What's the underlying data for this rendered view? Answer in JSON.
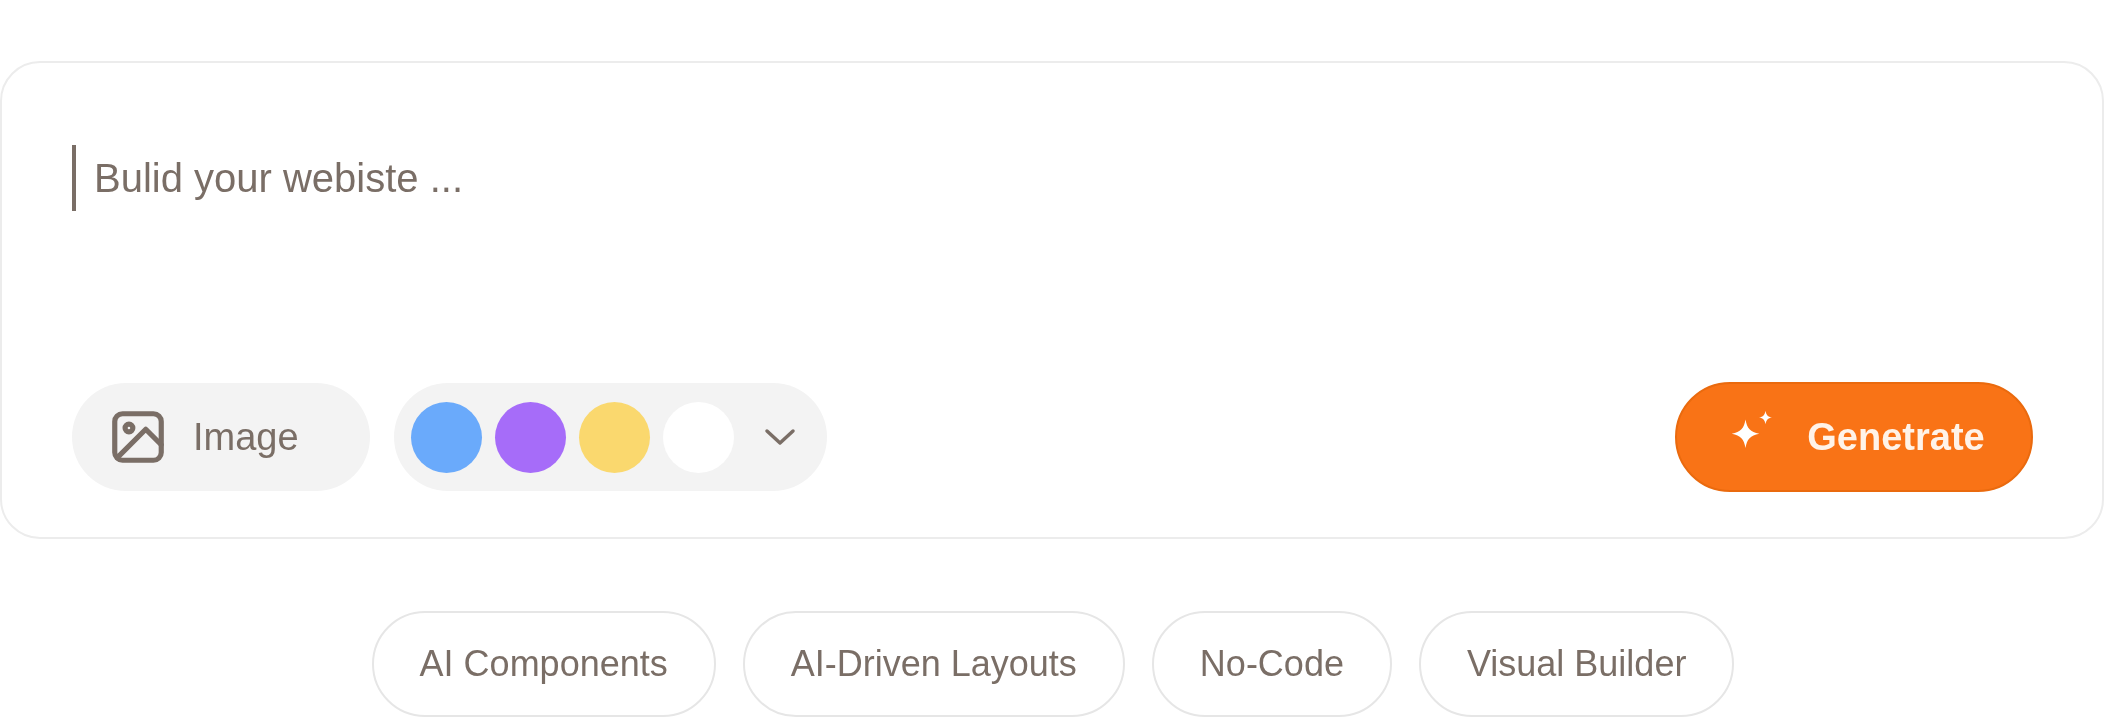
{
  "prompt": {
    "placeholder": "Bulid your webiste ..."
  },
  "image_button": {
    "label": "Image"
  },
  "palette": {
    "colors": [
      {
        "color": "#6aaafb"
      },
      {
        "color": "#a66cf9"
      },
      {
        "color": "#fad86e"
      },
      {
        "color": "#ffffff"
      }
    ]
  },
  "generate_button": {
    "label": "Genetrate"
  },
  "suggestions": [
    {
      "label": "AI Components"
    },
    {
      "label": "AI-Driven Layouts"
    },
    {
      "label": "No-Code"
    },
    {
      "label": "Visual Builder"
    }
  ]
}
